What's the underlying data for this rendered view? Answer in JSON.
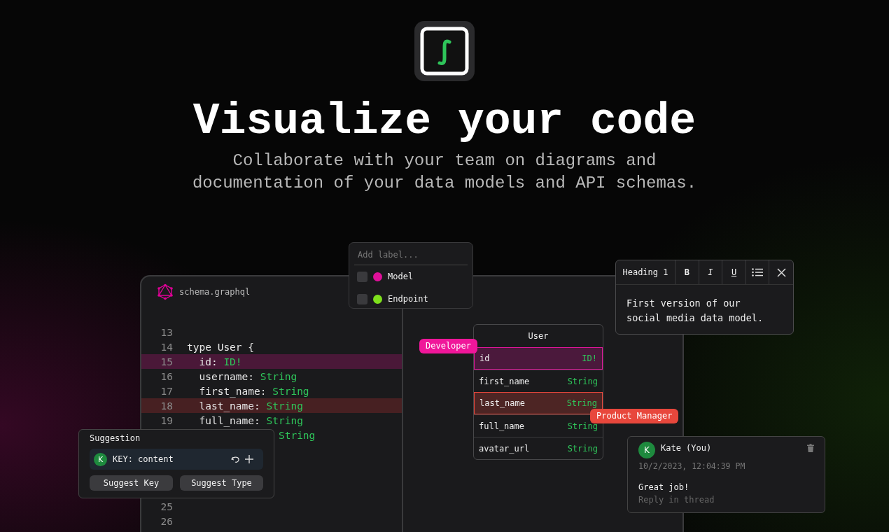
{
  "hero": {
    "title": "Visualize your code",
    "subtitle_lines": [
      "Collaborate with your team on diagrams and",
      "documentation of your data models and API schemas."
    ]
  },
  "code_window": {
    "file_name": "schema.graphql",
    "lines": [
      {
        "number": "13"
      },
      {
        "number": "14",
        "field": "type User {"
      },
      {
        "number": "15",
        "field": "  id: ",
        "type": "ID!",
        "color": "#4a1838"
      },
      {
        "number": "16",
        "field": "  username: ",
        "type": "String"
      },
      {
        "number": "17",
        "field": "  first_name: ",
        "type": "String"
      },
      {
        "number": "18",
        "field": "  last_name: ",
        "type": "String",
        "color": "#472022"
      },
      {
        "number": "19",
        "field": "  full_name: ",
        "type": "String"
      },
      {
        "type": "String"
      }
    ],
    "tail_lines": [
      {
        "number": "25"
      },
      {
        "number": "26"
      }
    ]
  },
  "label_menu": {
    "placeholder": "Add label...",
    "items": [
      {
        "label": "Model",
        "checked": false,
        "color": "#e0109a"
      },
      {
        "label": "Endpoint",
        "checked": false,
        "color": "#7ee01c"
      }
    ]
  },
  "editor_card": {
    "toolbar": [
      {
        "kind": "dropdown",
        "text": "Heading 1"
      },
      {
        "kind": "bold",
        "text": "B"
      },
      {
        "kind": "italic",
        "text": "I"
      },
      {
        "kind": "underline",
        "text": "U"
      },
      {
        "kind": "list"
      },
      {
        "kind": "close"
      }
    ],
    "body": "First version of our social media data model."
  },
  "table": {
    "title": "User",
    "rows": [
      {
        "name": "id",
        "type": "ID!",
        "color": "#e0169a"
      },
      {
        "name": "first_name",
        "type": "String"
      },
      {
        "name": "last_name",
        "type": "String",
        "color": "#e8473c"
      },
      {
        "name": "full_name",
        "type": "String"
      },
      {
        "name": "avatar_url",
        "type": "String"
      }
    ]
  },
  "tags": [
    {
      "text": "Developer",
      "color": "#f0169a"
    },
    {
      "text": "Product Manager",
      "color": "#e8473c"
    }
  ],
  "suggestion": {
    "title": "Suggestion",
    "avatar": "K",
    "text": "KEY: content",
    "buttons": [
      "Suggest Key",
      "Suggest Type"
    ]
  },
  "comment": {
    "avatar": "K",
    "author": "Kate (You)",
    "time": "10/2/2023, 12:04:39 PM",
    "text": "Great job!",
    "reply": "Reply in thread"
  }
}
